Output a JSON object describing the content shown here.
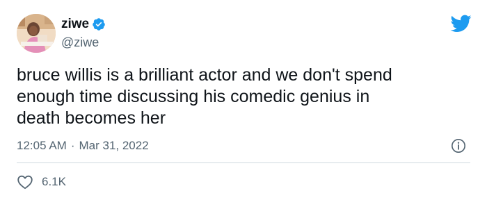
{
  "tweet": {
    "author": {
      "display_name": "ziwe",
      "handle": "@ziwe",
      "verified": true
    },
    "text": "bruce willis is a brilliant actor and we don't spend\nenough time discussing his comedic genius in\ndeath becomes her",
    "time": "12:05 AM",
    "separator": "·",
    "date": "Mar 31, 2022",
    "like_count": "6.1K"
  },
  "icons": {
    "brand": "twitter-bird-icon",
    "verified": "verified-badge-icon",
    "info": "info-icon",
    "like": "heart-icon"
  },
  "colors": {
    "twitter_blue": "#1d9bf0",
    "text_primary": "#0f1419",
    "text_secondary": "#536471",
    "divider": "#cfd9de"
  }
}
